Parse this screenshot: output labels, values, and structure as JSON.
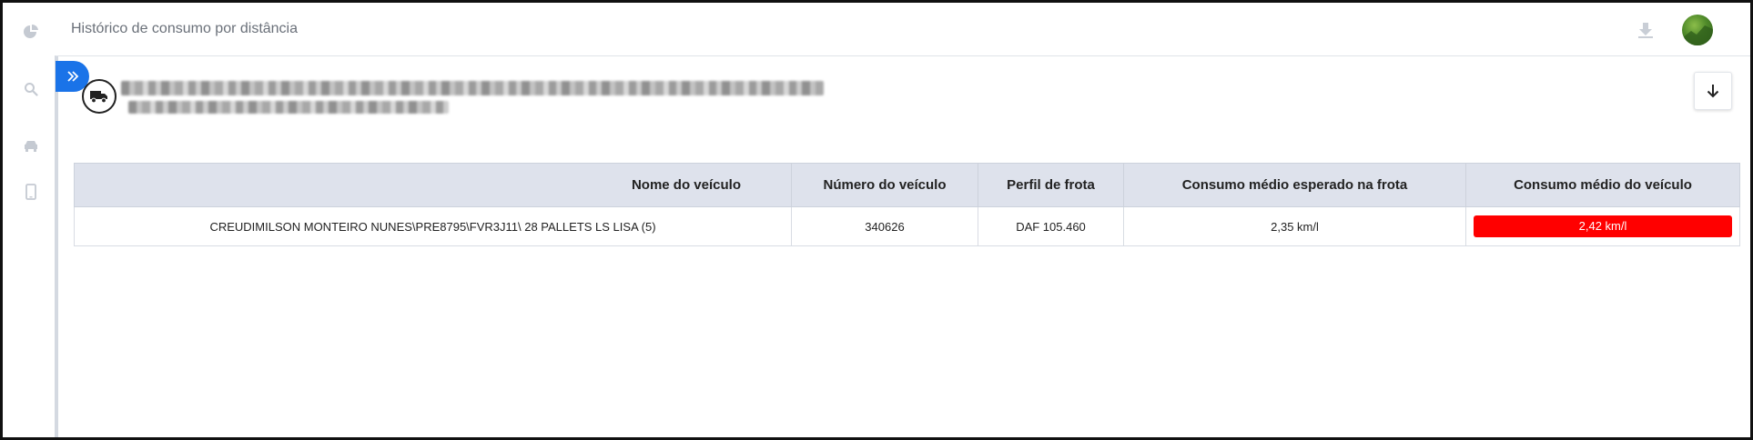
{
  "header": {
    "title": "Histórico de consumo por distância"
  },
  "sidebar": {
    "items": [
      {
        "icon": "pie-chart-icon"
      },
      {
        "icon": "search-icon"
      },
      {
        "icon": "car-icon"
      },
      {
        "icon": "mobile-phone-icon"
      }
    ]
  },
  "colors": {
    "accent": "#1a73e8",
    "header_row": "#dee2ec",
    "alert": "#ff0000"
  },
  "table": {
    "columns": [
      "Nome do veículo",
      "Número do veículo",
      "Perfil de frota",
      "Consumo médio esperado na frota",
      "Consumo médio do veículo"
    ],
    "rows": [
      {
        "nome": "CREUDIMILSON MONTEIRO NUNES\\PRE8795\\FVR3J11\\ 28 PALLETS LS LISA (5)",
        "numero": "340626",
        "perfil": "DAF 105.460",
        "esperado": "2,35 km/l",
        "consumo": "2,42 km/l"
      }
    ]
  }
}
